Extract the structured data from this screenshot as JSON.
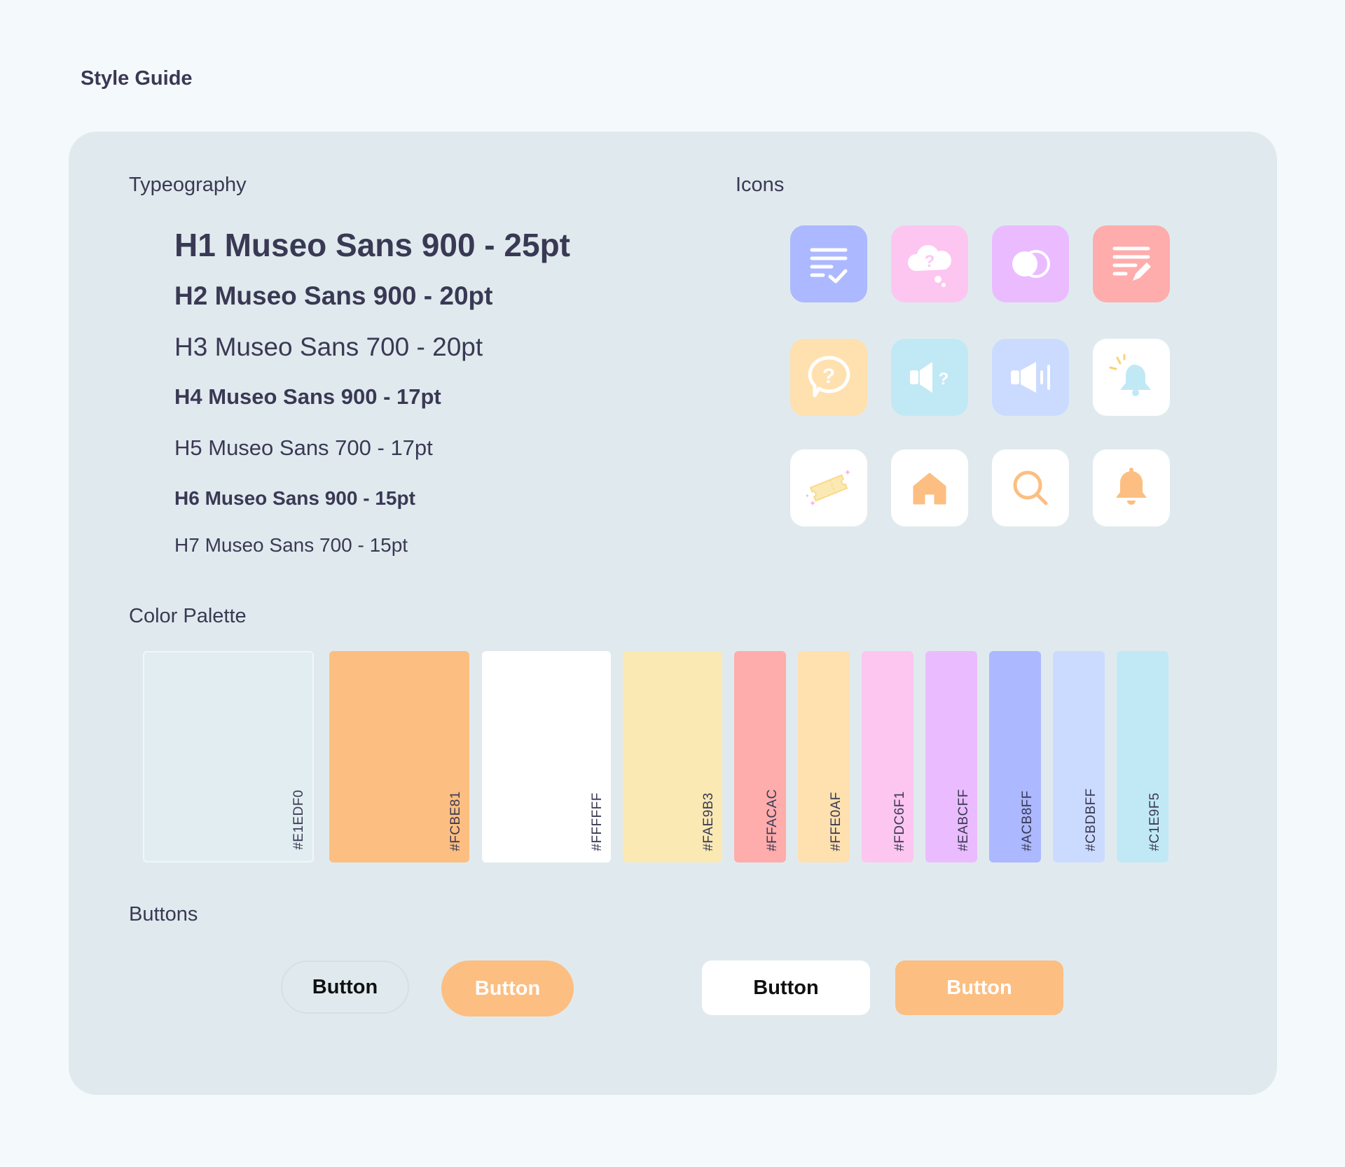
{
  "page": {
    "title": "Style Guide"
  },
  "typography": {
    "label": "Typeography",
    "lines": [
      "H1 Museo Sans 900 - 25pt",
      "H2 Museo Sans 900 - 20pt",
      "H3 Museo Sans 700 - 20pt",
      "H4 Museo Sans 900 - 17pt",
      "H5 Museo Sans 700 - 17pt",
      "H6 Museo Sans 900 - 15pt",
      "H7 Museo Sans 700 - 15pt"
    ]
  },
  "icons": {
    "label": "Icons",
    "items": [
      {
        "name": "task-list-check-icon",
        "bg": "#ACB8FF"
      },
      {
        "name": "thought-cloud-question-icon",
        "bg": "#FDC6F1"
      },
      {
        "name": "overlapping-circles-icon",
        "bg": "#EABCFF"
      },
      {
        "name": "note-edit-icon",
        "bg": "#FFACAC"
      },
      {
        "name": "speech-bubble-question-icon",
        "bg": "#FFE0AF"
      },
      {
        "name": "speaker-question-icon",
        "bg": "#C1E9F5"
      },
      {
        "name": "speaker-volume-icon",
        "bg": "#CBDBFF"
      },
      {
        "name": "bell-ringing-icon",
        "bg": "#FFFFFF"
      },
      {
        "name": "ticket-sparkle-icon",
        "bg": "#FFFFFF"
      },
      {
        "name": "home-icon",
        "bg": "#FFFFFF"
      },
      {
        "name": "search-icon",
        "bg": "#FFFFFF"
      },
      {
        "name": "bell-icon",
        "bg": "#FFFFFF"
      }
    ]
  },
  "palette": {
    "label": "Color Palette",
    "colors": [
      "#E1EDF0",
      "#FCBE81",
      "#FFFFFF",
      "#FAE9B3",
      "#FFACAC",
      "#FFE0AF",
      "#FDC6F1",
      "#EABCFF",
      "#ACB8FF",
      "#CBDBFF",
      "#C1E9F5"
    ]
  },
  "buttons": {
    "label": "Buttons",
    "outline_pill": "Button",
    "orange_pill": "Button",
    "white_rect": "Button",
    "orange_rect": "Button"
  }
}
